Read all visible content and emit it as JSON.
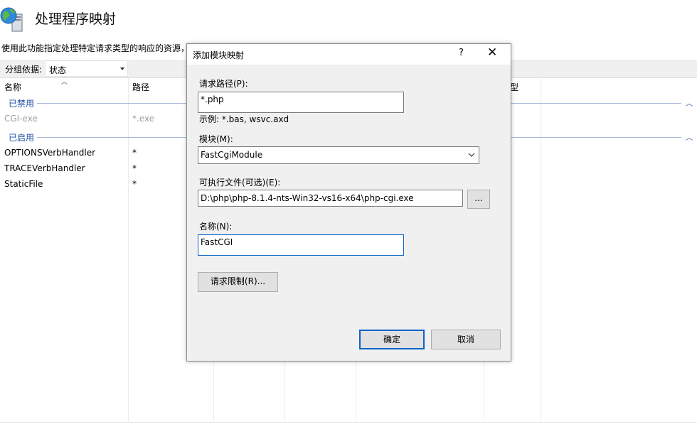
{
  "page": {
    "title": "处理程序映射",
    "description": "使用此功能指定处理特定请求类型的响应的资源，"
  },
  "toolbar": {
    "group_by_label": "分组依据:",
    "group_by_value": "状态"
  },
  "list": {
    "columns": [
      "名称",
      "路径",
      "类型"
    ],
    "groups": [
      {
        "label": "已禁用",
        "rows": [
          {
            "name": "CGI-exe",
            "path": "*.exe"
          }
        ]
      },
      {
        "label": "已启用",
        "rows": [
          {
            "name": "OPTIONSVerbHandler",
            "path": "*"
          },
          {
            "name": "TRACEVerbHandler",
            "path": "*"
          },
          {
            "name": "StaticFile",
            "path": "*"
          }
        ]
      }
    ]
  },
  "dialog": {
    "title": "添加模块映射",
    "help_glyph": "?",
    "close_glyph": "✕",
    "request_path_label": "请求路径(P):",
    "request_path_value": "*.php",
    "example_text": "示例: *.bas, wsvc.axd",
    "module_label": "模块(M):",
    "module_value": "FastCgiModule",
    "executable_label": "可执行文件(可选)(E):",
    "executable_value": "D:\\php\\php-8.1.4-nts-Win32-vs16-x64\\php-cgi.exe",
    "browse_label": "...",
    "name_label": "名称(N):",
    "name_value": "FastCGI",
    "request_restrictions_label": "请求限制(R)...",
    "ok_label": "确定",
    "cancel_label": "取消"
  },
  "colors": {
    "accent": "#0a64c8",
    "group_label": "#1e4fa8",
    "dialog_bg": "#f0f0f0",
    "disabled_text": "#a0a0a0"
  }
}
